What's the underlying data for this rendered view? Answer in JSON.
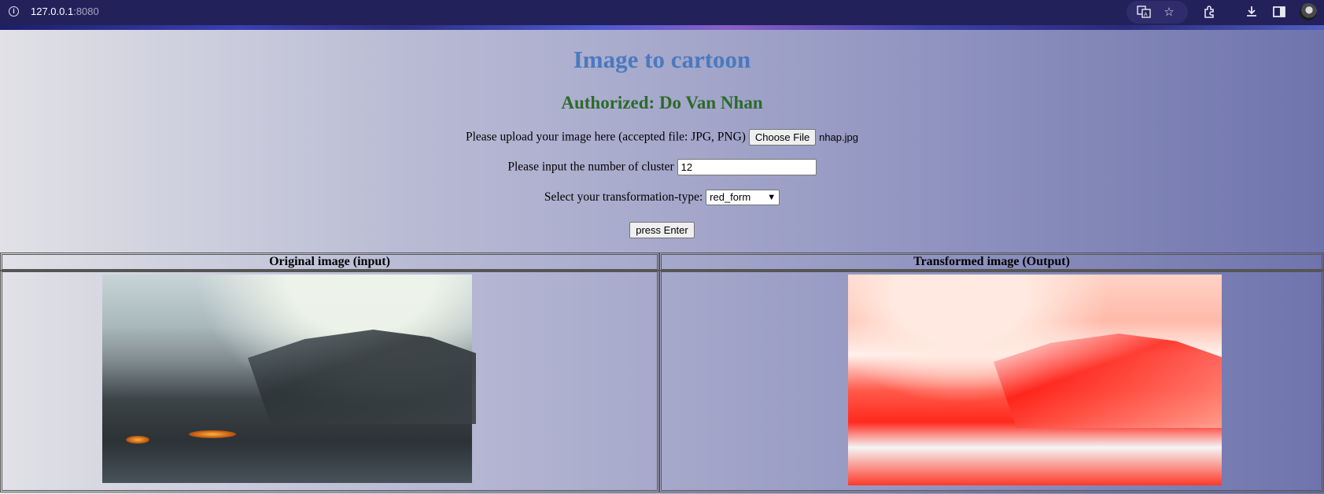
{
  "browser": {
    "url_host": "127.0.0.1",
    "url_port": ":8080",
    "icons": [
      "translate-icon",
      "star-icon",
      "extensions-icon",
      "download-icon",
      "sidebar-icon",
      "avatar"
    ]
  },
  "page": {
    "title": "Image to cartoon",
    "author": "Authorized: Do Van Nhan",
    "upload_label": "Please upload your image here (accepted file: JPG, PNG)",
    "choose_file_label": "Choose File",
    "file_name": "nhap.jpg",
    "cluster_label": "Please input the number of cluster",
    "cluster_value": "12",
    "transform_label": "Select your transformation-type:",
    "transform_selected": "red_form",
    "submit_label": "press Enter"
  },
  "results": {
    "input_header": "Original image (input)",
    "output_header": "Transformed image (Output)"
  },
  "colors": {
    "title": "#4a79c0",
    "author": "#2c6a2a",
    "browser_bar": "#23215a"
  }
}
